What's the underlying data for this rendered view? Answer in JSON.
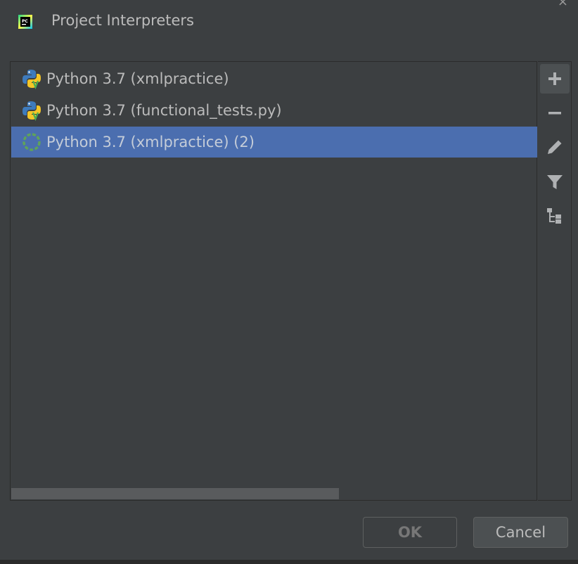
{
  "window": {
    "title": "Project Interpreters",
    "app_icon": "pycharm-icon",
    "close_glyph": "×"
  },
  "interpreters": [
    {
      "label": "Python 3.7 (xmlpractice)",
      "icon": "python-venv-icon",
      "selected": false
    },
    {
      "label": "Python 3.7 (functional_tests.py)",
      "icon": "python-venv-icon",
      "selected": false
    },
    {
      "label": "Python 3.7 (xmlpractice) (2)",
      "icon": "loading-spinner-icon",
      "selected": true
    }
  ],
  "toolbar": {
    "add": "plus-icon",
    "remove": "minus-icon",
    "edit": "pencil-icon",
    "filter": "filter-icon",
    "paths": "tree-paths-icon"
  },
  "buttons": {
    "ok_label": "OK",
    "cancel_label": "Cancel"
  },
  "colors": {
    "background": "#3c3f41",
    "selection": "#4b6eaf",
    "spinner": "#5fa35a"
  }
}
